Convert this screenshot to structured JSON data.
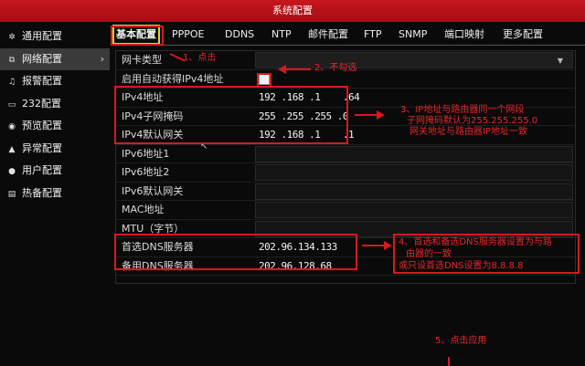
{
  "window": {
    "title": "系统配置"
  },
  "sidebar": {
    "items": [
      {
        "label": "通用配置",
        "icon": "gear-icon"
      },
      {
        "label": "网络配置",
        "icon": "network-icon",
        "active": true
      },
      {
        "label": "报警配置",
        "icon": "alarm-icon"
      },
      {
        "label": "232配置",
        "icon": "serial-port-icon"
      },
      {
        "label": "预览配置",
        "icon": "eye-icon"
      },
      {
        "label": "异常配置",
        "icon": "warning-icon"
      },
      {
        "label": "用户配置",
        "icon": "user-icon"
      },
      {
        "label": "热备配置",
        "icon": "backup-icon"
      }
    ],
    "active_arrow": "›"
  },
  "tabs": [
    {
      "label": "基本配置",
      "active": true
    },
    {
      "label": "PPPOE"
    },
    {
      "label": "DDNS"
    },
    {
      "label": "NTP"
    },
    {
      "label": "邮件配置"
    },
    {
      "label": "FTP"
    },
    {
      "label": "SNMP"
    },
    {
      "label": "端口映射"
    },
    {
      "label": "更多配置"
    }
  ],
  "form": {
    "rows": [
      {
        "label": "网卡类型",
        "value": ""
      },
      {
        "label": "启用自动获得IPv4地址",
        "value": "",
        "checkbox": true,
        "checked": false
      },
      {
        "label": "IPv4地址",
        "value": "192 .168 .1    .64"
      },
      {
        "label": "IPv4子网掩码",
        "value": "255 .255 .255 .0"
      },
      {
        "label": "IPv4默认网关",
        "value": "192 .168 .1    .1"
      },
      {
        "label": "IPv6地址1",
        "value": ""
      },
      {
        "label": "IPv6地址2",
        "value": ""
      },
      {
        "label": "IPv6默认网关",
        "value": ""
      },
      {
        "label": "MAC地址",
        "value": ""
      },
      {
        "label": "MTU（字节）",
        "value": ""
      },
      {
        "label": "首选DNS服务器",
        "value": "202.96.134.133"
      },
      {
        "label": "备用DNS服务器",
        "value": "202.96.128.68"
      }
    ]
  },
  "annotations": {
    "step1": "1、点击",
    "step2": "2、不勾选",
    "step3_line1": "3、IP地址与路由器同一个网段",
    "step3_line2": "子网掩码默认为255.255.255.0",
    "step3_line3": "网关地址与路由器IP地址一致",
    "step4_line1": "4、首选和备选DNS服务器设置为与路",
    "step4_line2": "由器的一致",
    "step4_line3": "或只设首选DNS设置为8.8.8.8",
    "step5": "5、点击应用"
  },
  "colors": {
    "titlebar": "#c8161d",
    "annotation": "#d9171e",
    "tab_highlight": "#e8d22a"
  }
}
